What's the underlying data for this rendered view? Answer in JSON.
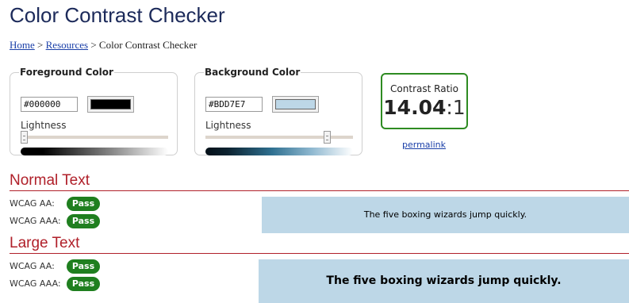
{
  "page": {
    "title": "Color Contrast Checker"
  },
  "breadcrumb": {
    "home": "Home",
    "separator": ">",
    "resources": "Resources",
    "current": "Color Contrast Checker"
  },
  "foreground": {
    "legend": "Foreground Color",
    "hex_value": "#000000",
    "swatch_color": "#000000",
    "lightness_label": "Lightness",
    "lightness_fraction": 0.0
  },
  "background": {
    "legend": "Background Color",
    "hex_value": "#BDD7E7",
    "swatch_color": "#BDD7E7",
    "lightness_label": "Lightness",
    "lightness_fraction": 0.84
  },
  "contrast": {
    "label": "Contrast Ratio",
    "ratio_value": "14.04",
    "ratio_suffix": ":1",
    "permalink": "permalink",
    "accent_color": "#2e8b22"
  },
  "normal_text": {
    "heading": "Normal Text",
    "aa_label": "WCAG AA:",
    "aa_result": "Pass",
    "aaa_label": "WCAG AAA:",
    "aaa_result": "Pass",
    "sample": "The five boxing wizards jump quickly."
  },
  "large_text": {
    "heading": "Large Text",
    "aa_label": "WCAG AA:",
    "aa_result": "Pass",
    "aaa_label": "WCAG AAA:",
    "aaa_result": "Pass",
    "sample": "The five boxing wizards jump quickly."
  },
  "colors": {
    "heading_red": "#b0202a",
    "pass_green": "#1f7f1f",
    "title_navy": "#1c2a5a"
  }
}
